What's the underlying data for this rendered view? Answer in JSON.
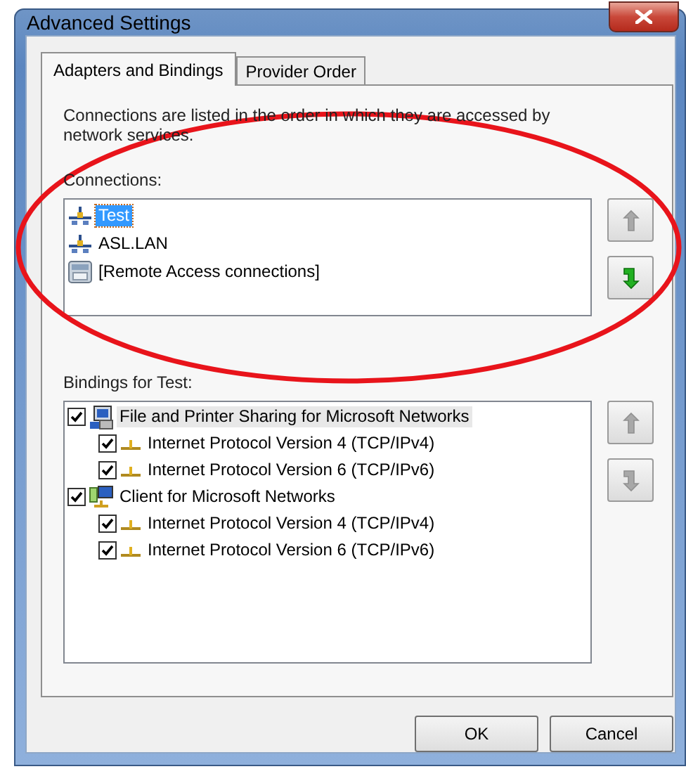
{
  "window": {
    "title": "Advanced Settings"
  },
  "tabs": [
    {
      "label": "Adapters and Bindings",
      "selected": true
    },
    {
      "label": "Provider Order",
      "selected": false
    }
  ],
  "description": "Connections are listed in the order in which they are accessed by network services.",
  "connections_label": "Connections:",
  "connections": [
    {
      "label": "Test",
      "kind": "lan",
      "selected": true
    },
    {
      "label": "ASL.LAN",
      "kind": "lan",
      "selected": false
    },
    {
      "label": "[Remote Access connections]",
      "kind": "dialup",
      "selected": false
    }
  ],
  "connection_buttons": [
    {
      "kind": "up",
      "disabled": true
    },
    {
      "kind": "down",
      "disabled": false
    }
  ],
  "bindings_label": "Bindings for Test:",
  "bindings": [
    {
      "label": "File and Printer Sharing for Microsoft Networks",
      "kind": "sharing",
      "checked": true,
      "selected": true,
      "children": [
        {
          "label": "Internet Protocol Version 4 (TCP/IPv4)",
          "checked": true,
          "selected": false
        },
        {
          "label": "Internet Protocol Version 6 (TCP/IPv6)",
          "checked": true,
          "selected": false
        }
      ]
    },
    {
      "label": "Client for Microsoft Networks",
      "kind": "client",
      "checked": true,
      "selected": false,
      "children": [
        {
          "label": "Internet Protocol Version 4 (TCP/IPv4)",
          "checked": true,
          "selected": false
        },
        {
          "label": "Internet Protocol Version 6 (TCP/IPv6)",
          "checked": true,
          "selected": false
        }
      ]
    }
  ],
  "binding_buttons": [
    {
      "kind": "up",
      "disabled": true
    },
    {
      "kind": "down",
      "disabled": true
    }
  ],
  "buttons": [
    "OK",
    "Cancel"
  ],
  "annotations": [
    {
      "kind": "ellipse",
      "color": "#e8141b"
    }
  ]
}
